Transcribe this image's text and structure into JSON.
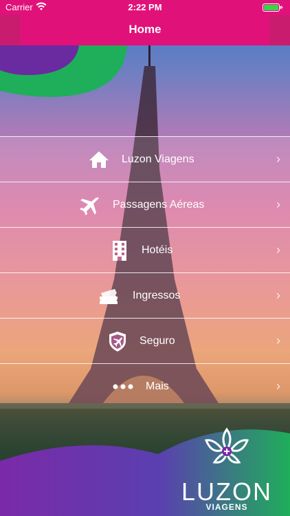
{
  "status_bar": {
    "carrier": "Carrier",
    "time": "2:22 PM"
  },
  "header": {
    "title": "Home"
  },
  "menu": [
    {
      "label": "Luzon Viagens",
      "icon": "home-icon"
    },
    {
      "label": "Passagens Aéreas",
      "icon": "airplane-icon"
    },
    {
      "label": "Hotéis",
      "icon": "hotel-building-icon"
    },
    {
      "label": "Ingressos",
      "icon": "tickets-icon"
    },
    {
      "label": "Seguro",
      "icon": "shield-plane-icon"
    },
    {
      "label": "Mais",
      "icon": "more-dots-icon"
    }
  ],
  "brand": {
    "name": "LUZON",
    "subtitle": "VIAGENS"
  },
  "colors": {
    "header": "#e0127a",
    "accent_green": "#1fae5a",
    "accent_purple": "#6a2aa0"
  }
}
